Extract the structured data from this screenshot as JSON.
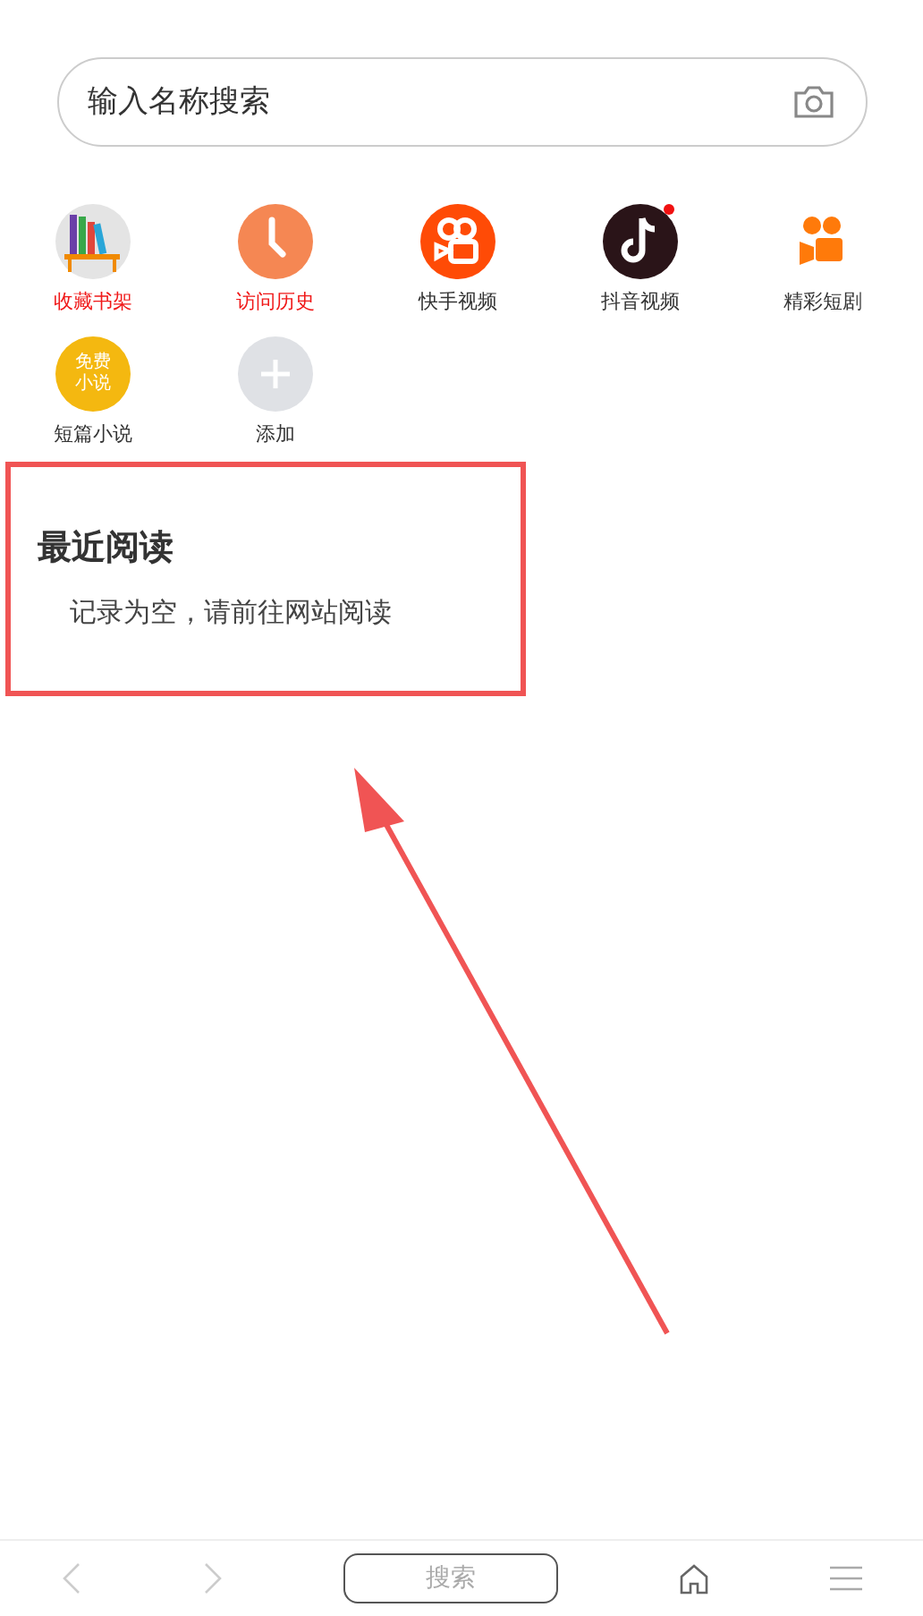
{
  "search": {
    "placeholder": "输入名称搜索"
  },
  "shortcuts": [
    {
      "label": "收藏书架",
      "kind": "books",
      "highlighted": true
    },
    {
      "label": "访问历史",
      "kind": "clock",
      "highlighted": true
    },
    {
      "label": "快手视频",
      "kind": "camera",
      "highlighted": false
    },
    {
      "label": "抖音视频",
      "kind": "note",
      "highlighted": false,
      "dot": true
    },
    {
      "label": "精彩短剧",
      "kind": "film",
      "highlighted": false
    },
    {
      "label": "短篇小说",
      "kind": "novel",
      "highlighted": false,
      "badge": [
        "免费",
        "小说"
      ]
    },
    {
      "label": "添加",
      "kind": "add",
      "highlighted": false
    }
  ],
  "recent": {
    "title": "最近阅读",
    "empty_text": "记录为空，请前往网站阅读"
  },
  "bottom_bar": {
    "search_label": "搜索"
  }
}
